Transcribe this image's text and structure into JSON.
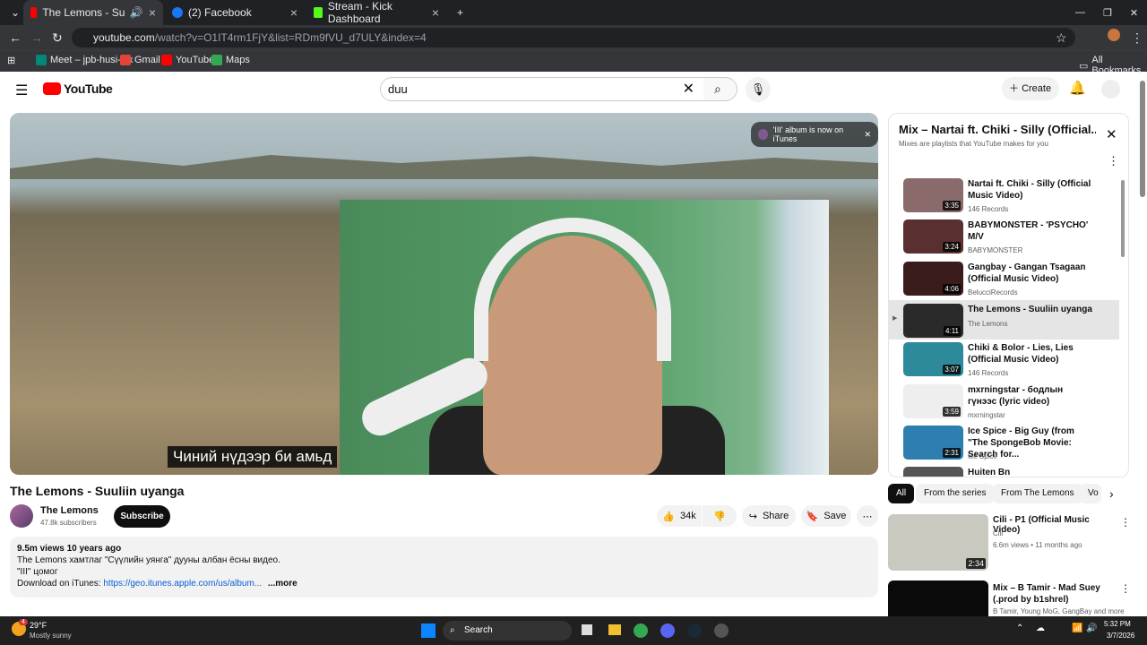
{
  "browser": {
    "tabs": [
      {
        "title": "The Lemons - Suuliin uyang",
        "active": true
      },
      {
        "title": "(2) Facebook",
        "active": false
      },
      {
        "title": "Stream - Kick Dashboard",
        "active": false
      }
    ],
    "url_host": "youtube.com",
    "url_path": "/watch?v=O1IT4rm1FjY&list=RDm9fVU_d7ULY&index=4",
    "bookmarks": [
      "Meet – jpb-husi-cjx",
      "Gmail",
      "YouTube",
      "Maps"
    ],
    "all_bookmarks": "All Bookmarks"
  },
  "yt": {
    "logo": "YouTube",
    "search_value": "duu",
    "create": "Create"
  },
  "video": {
    "subtitle": "Чиний нүдээр би амьд",
    "banner": "'III' album is now on iTunes",
    "title": "The Lemons - Suuliin uyanga",
    "channel": "The Lemons",
    "subscribers": "47.8k subscribers",
    "subscribe": "Subscribe",
    "likes": "34k",
    "share": "Share",
    "save": "Save",
    "views": "9.5m views  10 years ago",
    "desc1": "The Lemons хамтлаг  \"Сүүлийн уянга\" дууны албан ёсны видео.",
    "desc2": "\"III\" цомог",
    "desc3_label": "Download on iTunes: ",
    "desc3_link": "https://geo.itunes.apple.com/us/album...",
    "more": "...more"
  },
  "playlist": {
    "title": "Mix – Nartai ft. Chiki - Silly (Official...",
    "subtitle": "Mixes are playlists that YouTube makes for you",
    "items": [
      {
        "title": "Nartai ft. Chiki - Silly (Official Music Video)",
        "channel": "146 Records",
        "dur": "3:35"
      },
      {
        "title": "BABYMONSTER - 'PSYCHO' M/V",
        "channel": "BABYMONSTER",
        "dur": "3:24"
      },
      {
        "title": "Gangbay - Gangan Tsagaan (Official Music Video)",
        "channel": "BelucciRecords",
        "dur": "4:06"
      },
      {
        "title": "The Lemons - Suuliin uyanga",
        "channel": "The Lemons",
        "dur": "4:11"
      },
      {
        "title": "Chiki & Bolor - Lies, Lies (Official Music Video)",
        "channel": "146 Records",
        "dur": "3:07"
      },
      {
        "title": "mxrningstar - бодлын гүнээс (lyric video)",
        "channel": "mxrningstar",
        "dur": "3:59"
      },
      {
        "title": "Ice Spice - Big Guy (from \"The SpongeBob Movie: Search for...",
        "channel": "Ice Spice",
        "dur": "2:31"
      },
      {
        "title": "Huiten Bn",
        "channel": "",
        "dur": ""
      }
    ]
  },
  "chips": [
    "All",
    "From the series",
    "From The Lemons",
    "Vo"
  ],
  "related": [
    {
      "title": "Cili - P1 (Official Music Video)",
      "channel": "Cili",
      "meta": "6.6m views • 11 months ago",
      "dur": "2:34"
    },
    {
      "title": "Mix – B Tamir - Mad Suey (.prod by b1shrel)",
      "channel": "B Tamir, Young MoG, GangBay and more",
      "meta": "",
      "dur": ""
    }
  ],
  "taskbar": {
    "temp": "29°F",
    "weather": "Mostly sunny",
    "search": "Search",
    "time": "5:32 PM",
    "date": "3/7/2026",
    "badge": "4"
  }
}
